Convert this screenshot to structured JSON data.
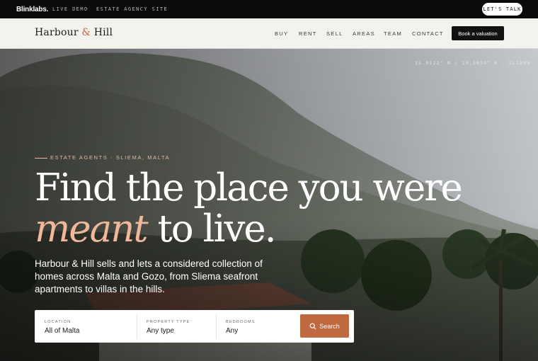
{
  "demo_bar": {
    "logo": "Blinklabs.",
    "live_demo": "LIVE DEMO",
    "separator": "·",
    "site_type": "ESTATE AGENCY SITE",
    "cta": "LET'S TALK"
  },
  "nav": {
    "brand_first": "Harbour",
    "brand_amp": "&",
    "brand_last": "Hill",
    "items": [
      "BUY",
      "RENT",
      "SELL",
      "AREAS",
      "TEAM",
      "CONTACT"
    ],
    "book_button": "Book a valuation"
  },
  "hero": {
    "coords": "35.9122° N / 14.5019° E · SLIEMA",
    "eyebrow": "ESTATE AGENTS · SLIEMA, MALTA",
    "headline_line1": "Find the place you were",
    "headline_accent": "meant",
    "headline_line2_rest": " to live.",
    "subtext": "Harbour & Hill sells and lets a considered collection of homes across Malta and Gozo, from Sliema seafront apartments to villas in the hills."
  },
  "search": {
    "location_label": "LOCATION",
    "location_value": "All of Malta",
    "type_label": "PROPERTY TYPE",
    "type_value": "Any type",
    "bedrooms_label": "BEDROOMS",
    "bedrooms_value": "Any",
    "button": "Search",
    "button_icon": "search-icon"
  },
  "colors": {
    "accent": "#c0683f",
    "accent_light": "#f0b79a",
    "nav_bg": "#f4f2ee",
    "dark": "#111111"
  }
}
